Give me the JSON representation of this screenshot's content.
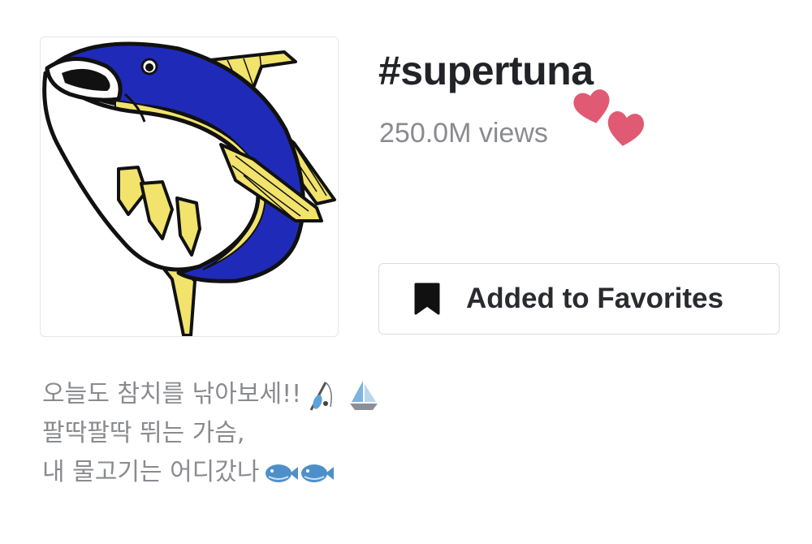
{
  "hashtag": {
    "title": "#supertuna",
    "views": "250.0M views"
  },
  "favorites_button": {
    "label": "Added to Favorites",
    "icon": "bookmark-icon"
  },
  "decorations": {
    "hearts": "two-hearts-icon",
    "heart_color": "#e05a74"
  },
  "cover": {
    "image": "tuna-illustration",
    "colors": {
      "body_blue": "#1f2bb8",
      "fin_yellow": "#f1e36b",
      "belly": "#ffffff"
    }
  },
  "caption": {
    "lines": [
      "오늘도 참치를 낚아보세!!",
      "팔딱팔딱 뛰는 가슴,",
      "내 물고기는 어디갔나"
    ],
    "emojis": [
      "fishing-rod-icon",
      "sailboat-icon",
      "blowfish-icon"
    ]
  }
}
